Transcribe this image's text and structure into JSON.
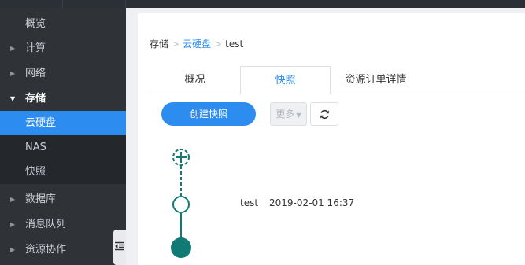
{
  "sidebar": {
    "items": [
      {
        "label": "概览"
      },
      {
        "label": "计算"
      },
      {
        "label": "网络"
      },
      {
        "label": "存储"
      },
      {
        "label": "数据库"
      },
      {
        "label": "消息队列"
      },
      {
        "label": "资源协作"
      }
    ],
    "storage_sub": [
      {
        "label": "云硬盘"
      },
      {
        "label": "NAS"
      },
      {
        "label": "快照"
      }
    ]
  },
  "breadcrumb": {
    "root": "存储",
    "sep": ">",
    "parent": "云硬盘",
    "current": "test"
  },
  "tabs": [
    {
      "label": "概况"
    },
    {
      "label": "快照"
    },
    {
      "label": "资源订单详情"
    }
  ],
  "toolbar": {
    "create_label": "创建快照",
    "more_label": "更多"
  },
  "snapshot": {
    "name": "test",
    "time": "2019-02-01 16:37"
  },
  "colors": {
    "accent": "#2d8cf0",
    "timeline": "#117a74",
    "sidebar_bg": "#2f3338"
  }
}
